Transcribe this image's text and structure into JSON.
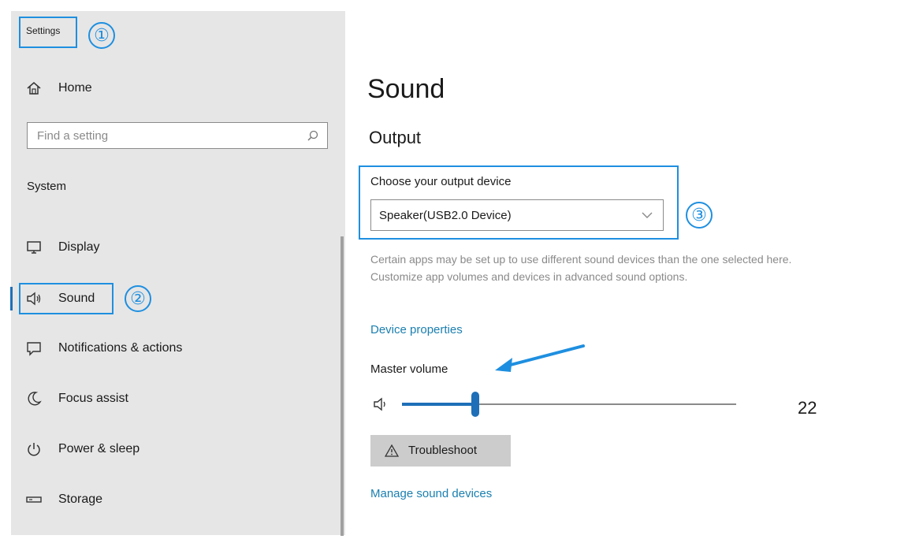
{
  "sidebar": {
    "title": "Settings",
    "home_label": "Home",
    "search_placeholder": "Find a setting",
    "section_label": "System",
    "items": [
      {
        "label": "Display",
        "icon": "monitor-icon"
      },
      {
        "label": "Sound",
        "icon": "speaker-icon",
        "active": true
      },
      {
        "label": "Notifications & actions",
        "icon": "notification-icon"
      },
      {
        "label": "Focus assist",
        "icon": "moon-icon"
      },
      {
        "label": "Power & sleep",
        "icon": "power-icon"
      },
      {
        "label": "Storage",
        "icon": "storage-icon"
      }
    ]
  },
  "main": {
    "title": "Sound",
    "output_heading": "Output",
    "output_device_label": "Choose your output device",
    "output_device_value": "Speaker(USB2.0 Device)",
    "description": "Certain apps may be set up to use different sound devices than the one selected here. Customize app volumes and devices in advanced sound options.",
    "device_properties_link": "Device properties",
    "master_volume_label": "Master volume",
    "master_volume_value": "22",
    "master_volume_level": 0.22,
    "troubleshoot_label": "Troubleshoot",
    "manage_devices_link": "Manage sound devices"
  },
  "annotations": {
    "step1": "①",
    "step2": "②",
    "step3": "③"
  },
  "colors": {
    "accent": "#1e6fb8",
    "callout": "#1e8fe0",
    "link": "#1a7fb0"
  }
}
